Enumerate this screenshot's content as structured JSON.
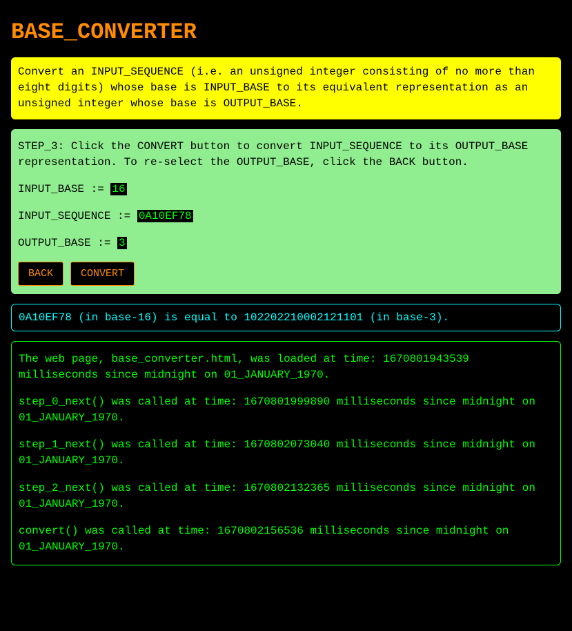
{
  "title": "BASE_CONVERTER",
  "description": "Convert an INPUT_SEQUENCE (i.e. an unsigned integer consisting of no more than eight digits) whose base is INPUT_BASE to its equivalent representation as an unsigned integer whose base is OUTPUT_BASE.",
  "step": {
    "instruction": "STEP_3: Click the CONVERT button to convert INPUT_SEQUENCE to its OUTPUT_BASE representation. To re-select the OUTPUT_BASE, click the BACK button.",
    "input_base_label": "INPUT_BASE := ",
    "input_base_value": "16",
    "input_sequence_label": "INPUT_SEQUENCE := ",
    "input_sequence_value": "0A10EF78",
    "output_base_label": "OUTPUT_BASE := ",
    "output_base_value": "3",
    "back_label": "BACK",
    "convert_label": "CONVERT"
  },
  "result": "0A10EF78 (in base-16) is equal to 102202210002121101 (in base-3).",
  "log": [
    "The web page, base_converter.html, was loaded at time: 1670801943539 milliseconds since midnight on 01_JANUARY_1970.",
    "step_0_next() was called at time: 1670801999890 milliseconds since midnight on 01_JANUARY_1970.",
    "step_1_next() was called at time: 1670802073040 milliseconds since midnight on 01_JANUARY_1970.",
    "step_2_next() was called at time: 1670802132365 milliseconds since midnight on 01_JANUARY_1970.",
    "convert() was called at time: 1670802156536 milliseconds since midnight on 01_JANUARY_1970."
  ]
}
